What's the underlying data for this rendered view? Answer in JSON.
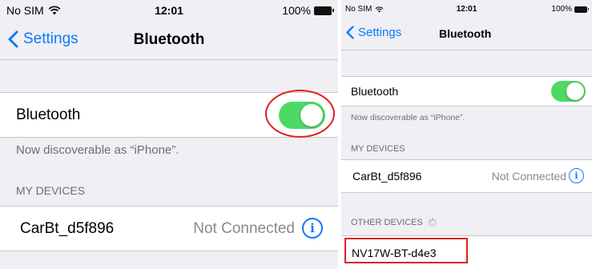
{
  "left": {
    "status": {
      "carrier": "No SIM",
      "time": "12:01",
      "battery": "100%"
    },
    "nav": {
      "back_label": "Settings",
      "title": "Bluetooth"
    },
    "bluetooth_row": {
      "label": "Bluetooth",
      "enabled": true
    },
    "discoverable_note": "Now discoverable as “iPhone”.",
    "my_devices_header": "MY DEVICES",
    "devices": [
      {
        "name": "CarBt_d5f896",
        "status": "Not Connected"
      }
    ]
  },
  "right": {
    "status": {
      "carrier": "No SIM",
      "time": "12:01",
      "battery": "100%"
    },
    "nav": {
      "back_label": "Settings",
      "title": "Bluetooth"
    },
    "bluetooth_row": {
      "label": "Bluetooth",
      "enabled": true
    },
    "discoverable_note": "Now discoverable as “iPhone”.",
    "my_devices_header": "MY DEVICES",
    "devices": [
      {
        "name": "CarBt_d5f896",
        "status": "Not Connected"
      }
    ],
    "other_devices_header": "OTHER DEVICES",
    "other_devices": [
      {
        "name": "NV17W-BT-d4e3"
      }
    ]
  },
  "colors": {
    "accent": "#0a7aff",
    "toggle_on": "#4cd964",
    "highlight": "#e02020",
    "background": "#efeff4"
  },
  "icons": [
    "wifi-icon",
    "battery-icon",
    "chevron-left-icon",
    "info-icon",
    "spinner-icon"
  ]
}
